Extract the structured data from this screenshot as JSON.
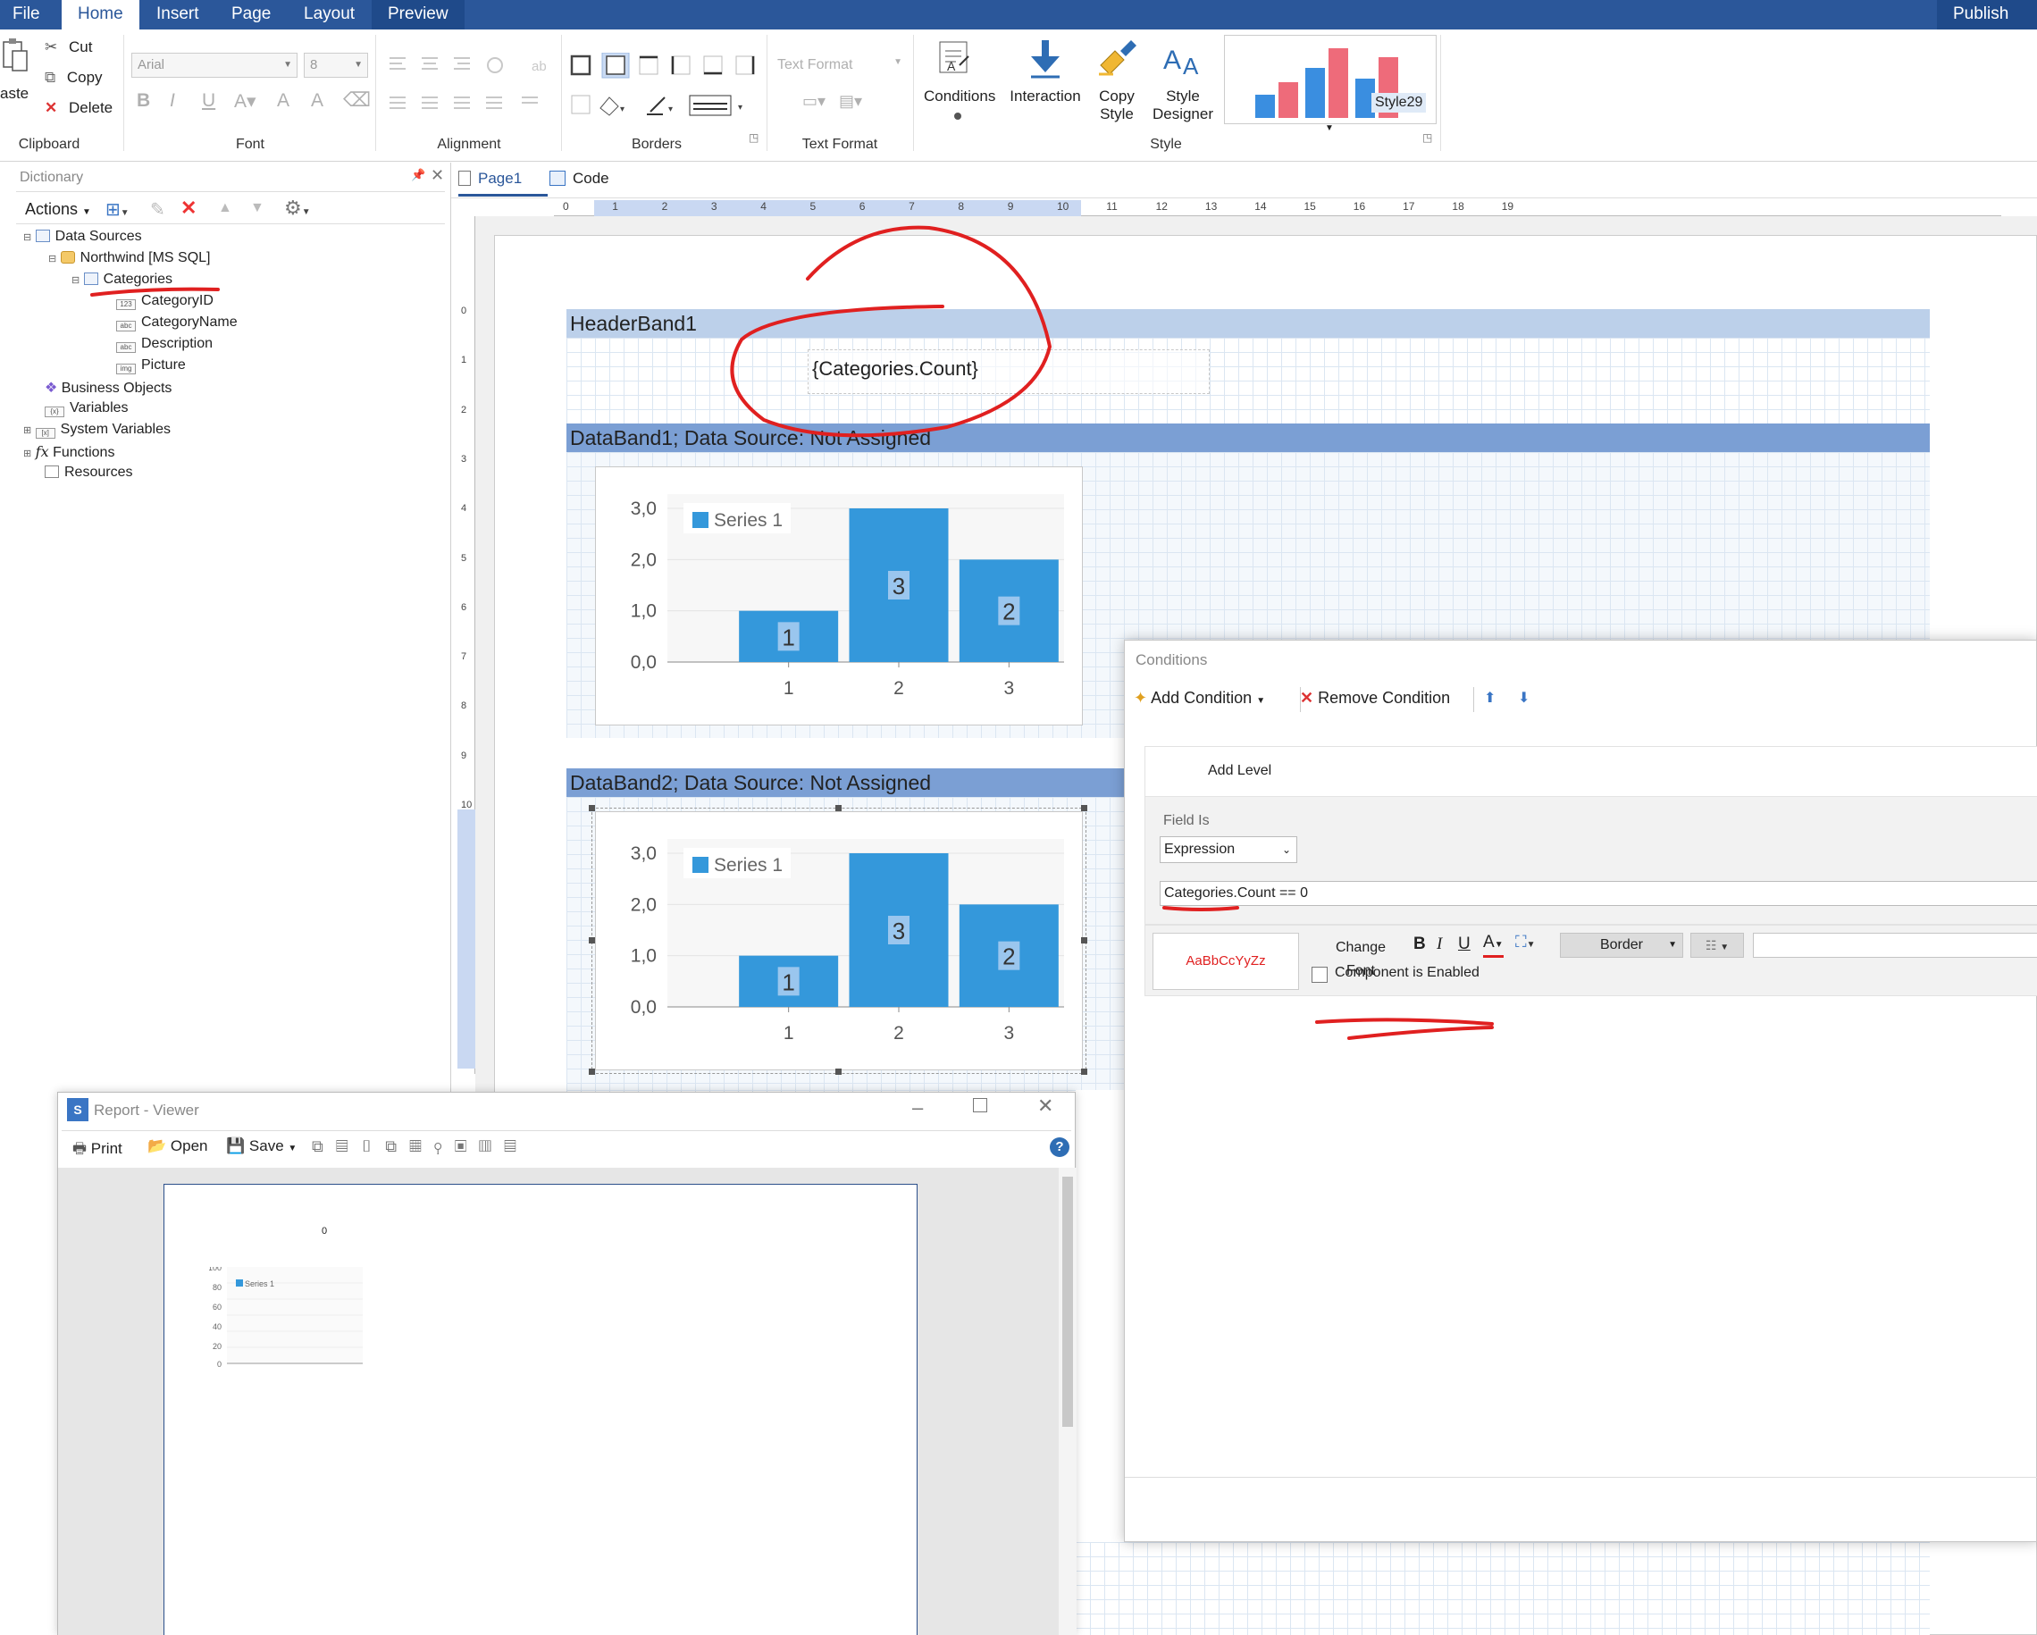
{
  "menu": {
    "tabs": [
      "File",
      "Home",
      "Insert",
      "Page",
      "Layout",
      "Preview"
    ],
    "active_tab": "Home",
    "publish": "Publish"
  },
  "ribbon": {
    "clipboard": {
      "paste": "aste",
      "cut": "Cut",
      "copy": "Copy",
      "delete": "Delete",
      "label": "Clipboard"
    },
    "font": {
      "family": "Arial",
      "size": "8",
      "label": "Font"
    },
    "alignment": {
      "label": "Alignment"
    },
    "borders": {
      "label": "Borders"
    },
    "text_format": {
      "combo": "Text Format",
      "label": "Text Format"
    },
    "style": {
      "conditions": "Conditions",
      "interaction": "Interaction",
      "copy_style_1": "Copy",
      "copy_style_2": "Style",
      "style_designer_1": "Style",
      "style_designer_2": "Designer",
      "gallery_item": "Style29",
      "label": "Style"
    }
  },
  "dictionary": {
    "title": "Dictionary",
    "actions": "Actions",
    "tree": {
      "data_sources": "Data Sources",
      "connection": "Northwind [MS SQL]",
      "table": "Categories",
      "fields": [
        {
          "type": "123",
          "name": "CategoryID"
        },
        {
          "type": "abc",
          "name": "CategoryName"
        },
        {
          "type": "abc",
          "name": "Description"
        },
        {
          "type": "img",
          "name": "Picture"
        }
      ],
      "business_objects": "Business Objects",
      "variables": "Variables",
      "system_variables": "System Variables",
      "functions": "Functions",
      "resources": "Resources"
    }
  },
  "designer": {
    "tabs": [
      "Page1",
      "Code"
    ],
    "active_tab": "Page1",
    "ruler_marks": [
      "0",
      "1",
      "2",
      "3",
      "4",
      "5",
      "6",
      "7",
      "8",
      "9",
      "10",
      "11",
      "12",
      "13",
      "14",
      "15",
      "16",
      "17",
      "18",
      "19"
    ],
    "vruler_marks": [
      "0",
      "1",
      "2",
      "3",
      "4",
      "5",
      "6",
      "7",
      "8",
      "9",
      "10"
    ],
    "header_band": {
      "title": "HeaderBand1",
      "expression": "{Categories.Count}"
    },
    "data_band1": {
      "title": "DataBand1; Data Source: Not Assigned"
    },
    "data_band2": {
      "title": "DataBand2; Data Source: Not Assigned"
    }
  },
  "chart_data": [
    {
      "type": "bar",
      "categories": [
        "1",
        "2",
        "3"
      ],
      "series": [
        {
          "name": "Series 1",
          "values": [
            1,
            3,
            2
          ]
        }
      ],
      "data_labels": [
        "1",
        "3",
        "2"
      ],
      "yticks": [
        "0,0",
        "1,0",
        "2,0",
        "3,0"
      ],
      "ylim": [
        0,
        3
      ],
      "legend": "top-left",
      "color": "#3498db"
    },
    {
      "type": "bar",
      "categories": [
        "1",
        "2",
        "3"
      ],
      "series": [
        {
          "name": "Series 1",
          "values": [
            1,
            3,
            2
          ]
        }
      ],
      "data_labels": [
        "1",
        "3",
        "2"
      ],
      "yticks": [
        "0,0",
        "1,0",
        "2,0",
        "3,0"
      ],
      "ylim": [
        0,
        3
      ],
      "legend": "top-left",
      "color": "#3498db"
    }
  ],
  "conditions_dialog": {
    "title": "Conditions",
    "add_condition": "Add Condition",
    "remove_condition": "Remove Condition",
    "add_level": "Add Level",
    "field_is_label": "Field Is",
    "field_is_value": "Expression",
    "expression": "Categories.Count == 0",
    "preview_text": "AaBbCcYyZz",
    "change_font": "Change Font",
    "border": "Border",
    "component_enabled": "Component is Enabled",
    "component_enabled_checked": false
  },
  "viewer": {
    "title": "Report - Viewer",
    "print": "Print",
    "open": "Open",
    "save": "Save",
    "page_value": "0",
    "mini_chart": {
      "legend": "Series 1",
      "yticks": [
        "100",
        "80",
        "60",
        "40",
        "20",
        "0"
      ]
    }
  },
  "colors": {
    "accent": "#2b579a",
    "band_header": "#bcd0ea",
    "data_band_header": "#7b9fd4",
    "bar": "#3498db",
    "annotation": "#e02020"
  }
}
